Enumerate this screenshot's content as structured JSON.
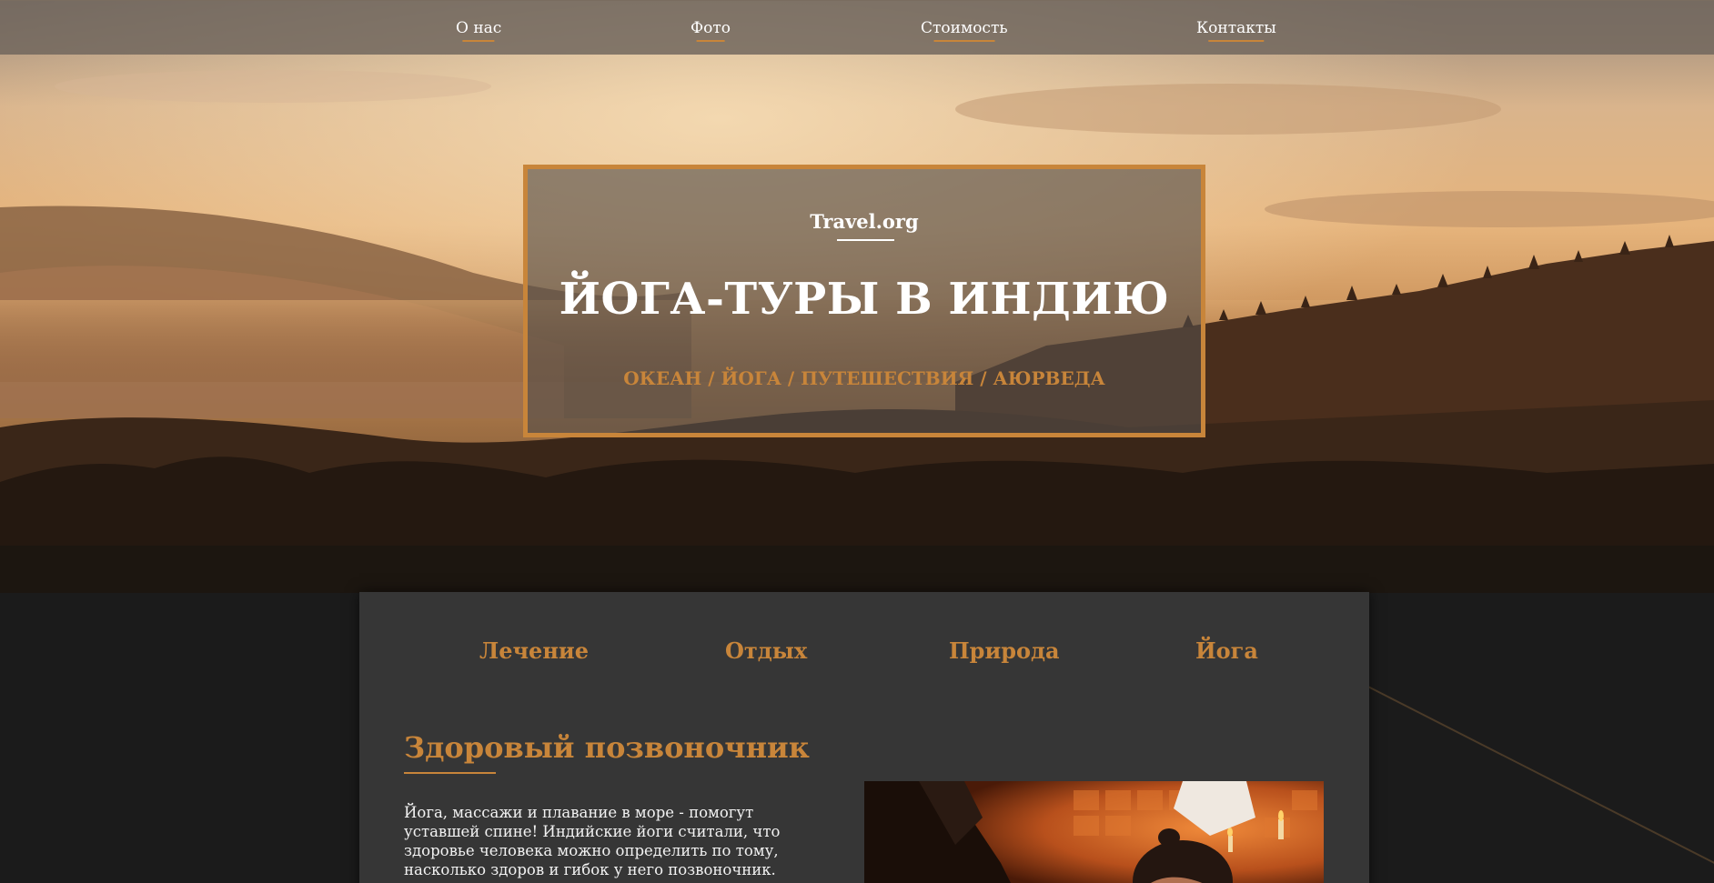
{
  "nav": {
    "items": [
      {
        "label": "О нас"
      },
      {
        "label": "Фото"
      },
      {
        "label": "Стоимость"
      },
      {
        "label": "Контакты"
      }
    ]
  },
  "hero": {
    "brand": "Travel.org",
    "title": "ЙОГА-ТУРЫ В ИНДИЮ",
    "tags": "ОКЕАН / ЙОГА / ПУТЕШЕСТВИЯ / АЮРВЕДА"
  },
  "categories": [
    {
      "label": "Лечение"
    },
    {
      "label": "Отдых"
    },
    {
      "label": "Природа"
    },
    {
      "label": "Йога"
    }
  ],
  "section": {
    "title": "Здоровый позвоночник",
    "text": "Йога, массажи и плавание в море - помогут уставшей спине! Индийские йоги считали, что здоровье человека можно определить по тому, насколько здоров и гибок у него позвоночник."
  },
  "colors": {
    "accent": "#c8853a",
    "panel": "#363636",
    "page_background": "#1b1b1b",
    "nav_background": "#6e645c"
  }
}
